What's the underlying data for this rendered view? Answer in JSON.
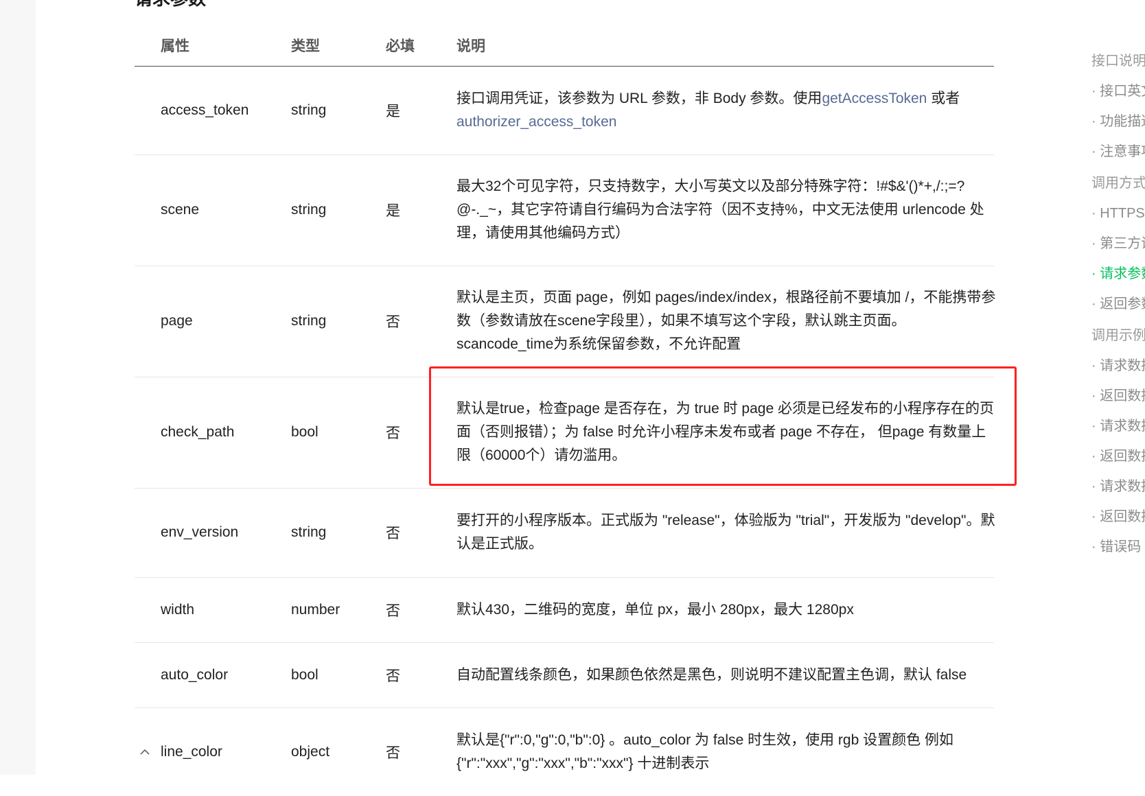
{
  "section_title": "请求参数",
  "table": {
    "headers": {
      "name": "属性",
      "type": "类型",
      "required": "必填",
      "desc": "说明"
    },
    "rows": [
      {
        "name": "access_token",
        "type": "string",
        "required": "是",
        "desc_prefix": "接口调用凭证，该参数为 URL 参数，非 Body 参数。使用",
        "link1": "getAccessToken",
        "desc_mid": " 或者 ",
        "link2": "authorizer_access_token"
      },
      {
        "name": "scene",
        "type": "string",
        "required": "是",
        "desc": "最大32个可见字符，只支持数字，大小写英文以及部分特殊字符：!#$&'()*+,/:;=?@-._~，其它字符请自行编码为合法字符（因不支持%，中文无法使用 urlencode 处理，请使用其他编码方式）"
      },
      {
        "name": "page",
        "type": "string",
        "required": "否",
        "desc": "默认是主页，页面 page，例如 pages/index/index，根路径前不要填加 /，不能携带参数（参数请放在scene字段里），如果不填写这个字段，默认跳主页面。scancode_time为系统保留参数，不允许配置"
      },
      {
        "name": "check_path",
        "type": "bool",
        "required": "否",
        "desc": "默认是true，检查page 是否存在，为 true 时 page 必须是已经发布的小程序存在的页面（否则报错）；为 false 时允许小程序未发布或者 page 不存在， 但page 有数量上限（60000个）请勿滥用。"
      },
      {
        "name": "env_version",
        "type": "string",
        "required": "否",
        "desc": "要打开的小程序版本。正式版为 \"release\"，体验版为 \"trial\"，开发版为 \"develop\"。默认是正式版。"
      },
      {
        "name": "width",
        "type": "number",
        "required": "否",
        "desc": "默认430，二维码的宽度，单位 px，最小 280px，最大 1280px"
      },
      {
        "name": "auto_color",
        "type": "bool",
        "required": "否",
        "desc": "自动配置线条颜色，如果颜色依然是黑色，则说明不建议配置主色调，默认 false"
      },
      {
        "name": "line_color",
        "type": "object",
        "required": "否",
        "desc": "默认是{\"r\":0,\"g\":0,\"b\":0} 。auto_color 为 false 时生效，使用 rgb 设置颜色 例如 {\"r\":\"xxx\",\"g\":\"xxx\",\"b\":\"xxx\"} 十进制表示"
      }
    ]
  },
  "toc": {
    "items": [
      {
        "label": "接口说明",
        "kind": "group"
      },
      {
        "label": "· 接口英文名",
        "kind": "sub"
      },
      {
        "label": "· 功能描述",
        "kind": "sub"
      },
      {
        "label": "· 注意事项",
        "kind": "sub"
      },
      {
        "label": "调用方式",
        "kind": "group"
      },
      {
        "label": "· HTTPS 调用",
        "kind": "sub"
      },
      {
        "label": "· 第三方调用",
        "kind": "sub"
      },
      {
        "label": "· 请求参数",
        "kind": "active"
      },
      {
        "label": "· 返回参数",
        "kind": "sub"
      },
      {
        "label": "调用示例",
        "kind": "group"
      },
      {
        "label": "· 请求数据示例",
        "kind": "sub"
      },
      {
        "label": "· 返回数据示例",
        "kind": "sub"
      },
      {
        "label": "· 请求数据示例",
        "kind": "sub"
      },
      {
        "label": "· 返回数据示例",
        "kind": "sub"
      },
      {
        "label": "· 请求数据示例",
        "kind": "sub"
      },
      {
        "label": "· 返回数据示例",
        "kind": "sub"
      },
      {
        "label": "· 错误码",
        "kind": "sub"
      }
    ]
  },
  "colors": {
    "link": "#576b95",
    "active": "#07c160",
    "highlight": "#ff2020"
  },
  "icons": {
    "expand": "chevron-up-icon"
  }
}
